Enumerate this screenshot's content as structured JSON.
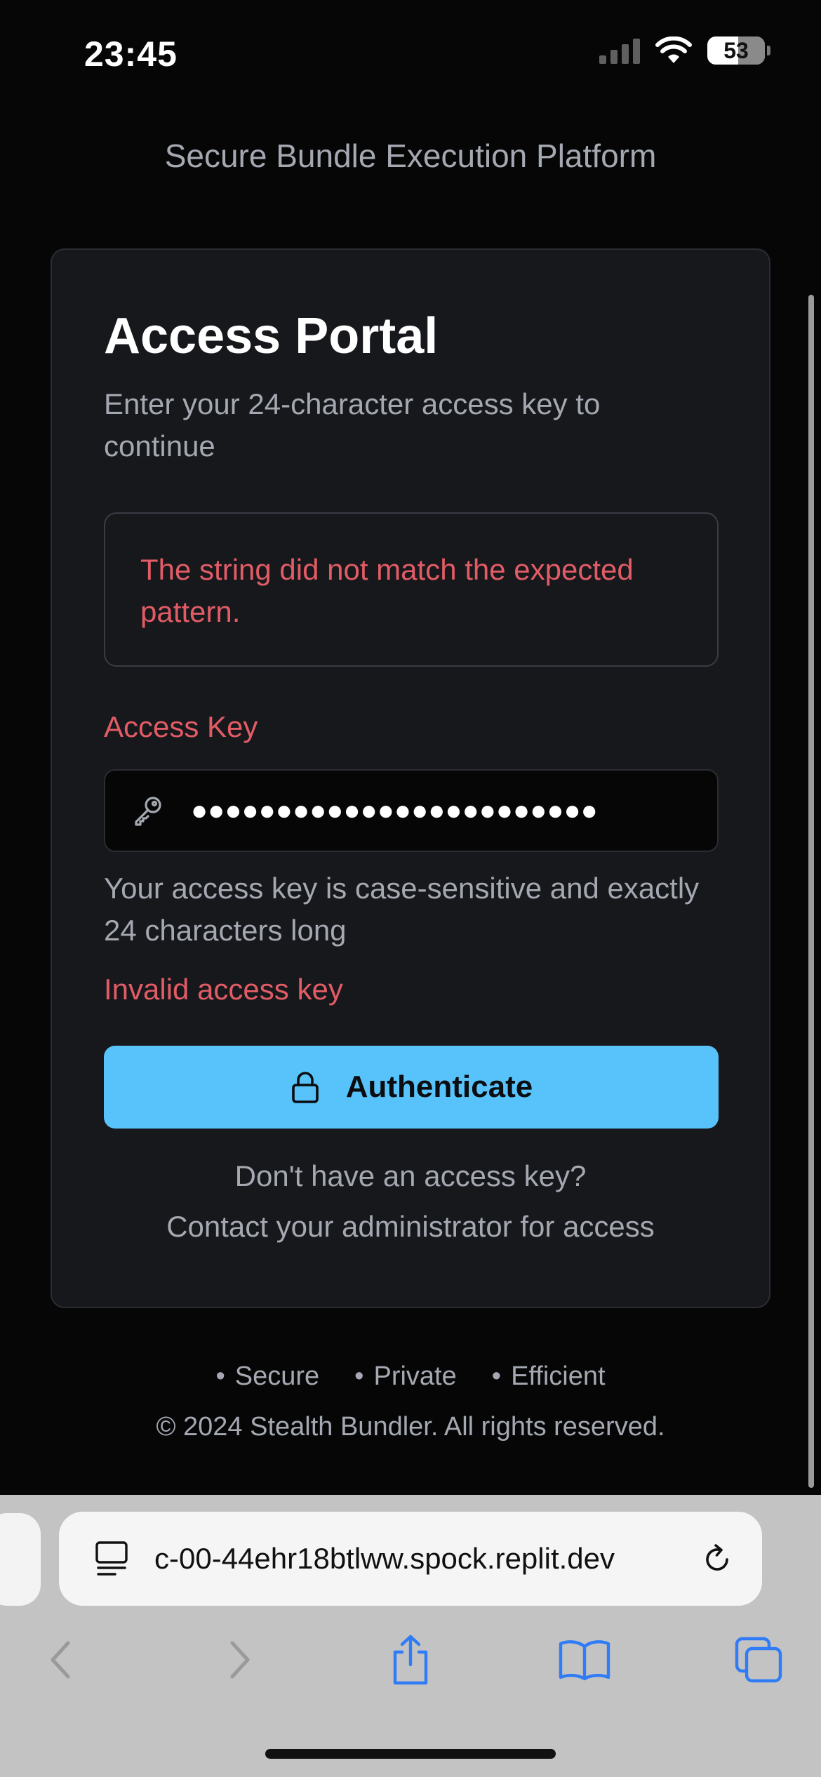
{
  "status": {
    "time": "23:45",
    "battery": "53"
  },
  "header": {
    "subtitle": "Secure Bundle Execution Platform"
  },
  "card": {
    "title": "Access Portal",
    "description": "Enter your 24-character access key to continue",
    "error_message": "The string did not match the expected pattern.",
    "field_label": "Access Key",
    "input_value": "●●●●●●●●●●●●●●●●●●●●●●●●",
    "hint": "Your access key is case-sensitive and exactly 24 characters long",
    "invalid_text": "Invalid access key",
    "button_label": "Authenticate",
    "no_key_text": "Don't have an access key?",
    "contact_text": "Contact your administrator for access"
  },
  "footer": {
    "items": [
      "Secure",
      "Private",
      "Efficient"
    ],
    "copyright": "© 2024 Stealth Bundler. All rights reserved."
  },
  "browser": {
    "url": "c-00-44ehr18btlww.spock.replit.dev"
  },
  "colors": {
    "accent": "#58c3fb",
    "error": "#e25c66",
    "card_bg": "#17181c"
  }
}
